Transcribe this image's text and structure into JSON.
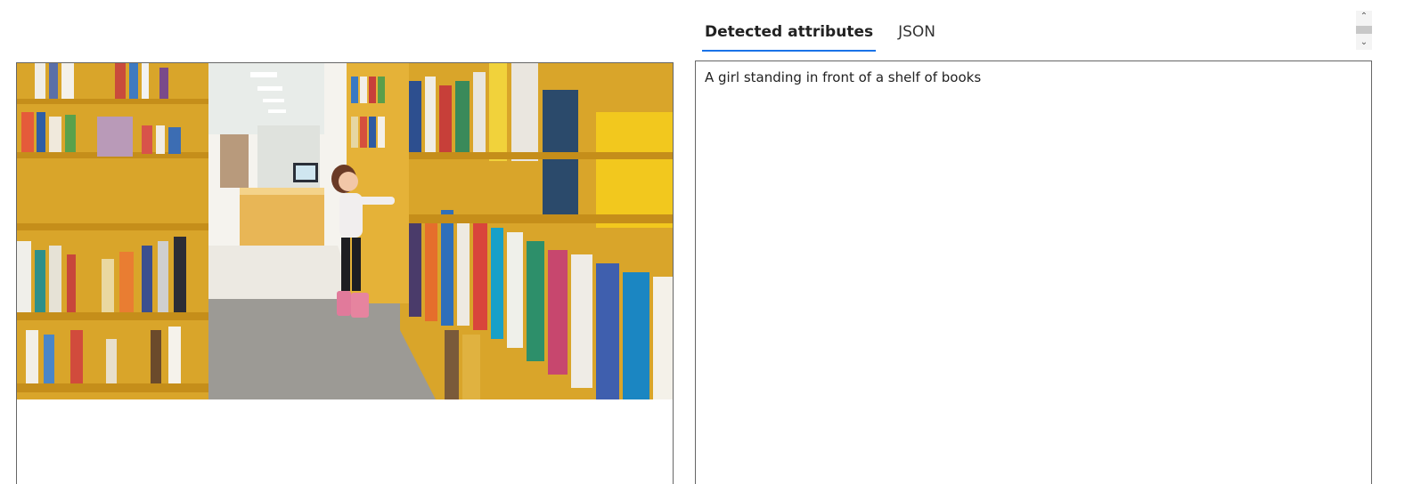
{
  "tabs": [
    {
      "label": "Detected attributes",
      "active": true
    },
    {
      "label": "JSON",
      "active": false
    }
  ],
  "result": {
    "caption": "A girl standing in front of a shelf of books"
  },
  "colors": {
    "tab_accent": "#1a73e8",
    "panel_border": "#666666",
    "shelf_wood": "#e9b83a"
  },
  "image": {
    "icon": "library-photo"
  }
}
